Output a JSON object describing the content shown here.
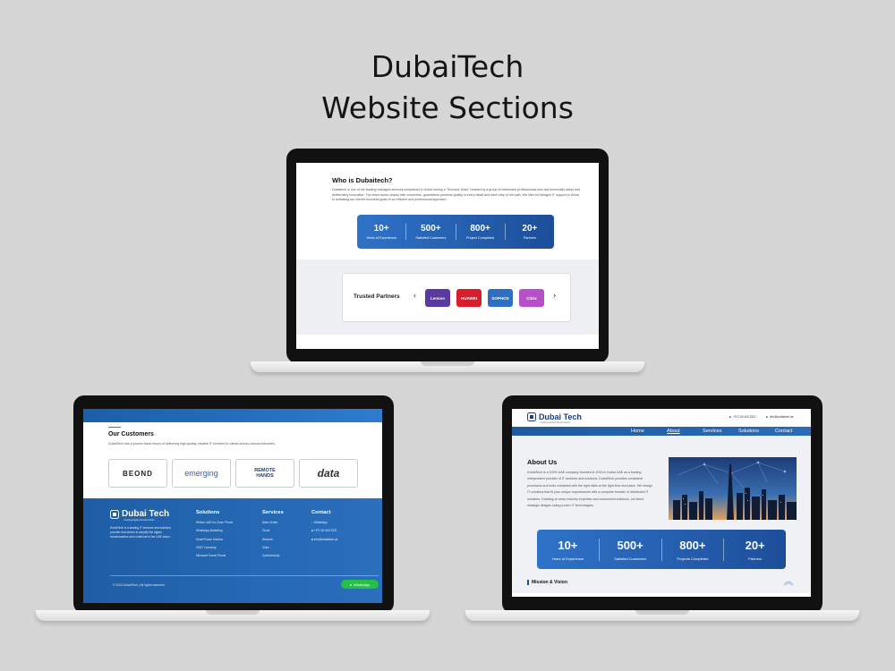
{
  "title_line1": "DubaiTech",
  "title_line2": "Website Sections",
  "screen_top": {
    "who_title": "Who is Dubaitech?",
    "who_text": "Dubaitech is one of the leading managed services companies in Dubai having a \"Success Team\" headed by a group of intellective professionals who are technically adept and deliberately innovative. The team works closely with customers, guarantees peerless quality in every detail and each step of the path. We offer full-fledged IT support in Dubai to activating our client's business goals in an efficient and professional approach.",
    "stats": [
      {
        "num": "10+",
        "label": "Years of Experience"
      },
      {
        "num": "500+",
        "label": "Satisfied Customers"
      },
      {
        "num": "800+",
        "label": "Project Completed"
      },
      {
        "num": "20+",
        "label": "Partners"
      }
    ],
    "partners_title": "Trusted Partners",
    "prev": "‹",
    "next": "›",
    "partner_logos": [
      {
        "name": "Lenovo",
        "color": "#5a3aa0"
      },
      {
        "name": "HUAWEI",
        "color": "#d81e2c"
      },
      {
        "name": "SOPHOS",
        "color": "#2d6fc1"
      },
      {
        "name": "Citrix",
        "color": "#b64fc8"
      }
    ]
  },
  "screen_left": {
    "customers_title": "Our Customers",
    "customers_text": "DubaiTech has a proven track record of delivering high-quality, reliable IT services to clients across various industries.",
    "customers": [
      "BEOND",
      "emerging",
      "REMOTE HANDS",
      "data"
    ],
    "brand": "Dubai Tech",
    "brand_tagline": "Creating digital transformation",
    "brand_desc": "DubaiTech is a leading IT services and solutions provider that strives to simplify the digital transformation and contribute to the UAE vision.",
    "solutions_title": "Solutions",
    "solutions": [
      "Ribbon UAE for Zoom Phone",
      "WhatsApp Marketing",
      "Smart Room Solution",
      "VSAT Licensing",
      "Microsoft Teams Phone"
    ],
    "services_title": "Services",
    "services": [
      "Data Center",
      "Cloud",
      "Network",
      "Voice",
      "Cybersecurity"
    ],
    "contact_title": "Contact",
    "contact_items": [
      "WhatsApp",
      "+971 50 400 3321",
      "info@dubaitech.ae"
    ],
    "copyright": "© 2024 DubaiTech | All rights reserved",
    "whatsapp_button": "WhatsApp"
  },
  "screen_right": {
    "logo": "Dubai Tech",
    "logo_tagline": "Creating digital transformation",
    "phone": "+971 50 400 3321",
    "email": "info@dubaitech.ae",
    "nav": [
      "Home",
      "About",
      "Services",
      "Solutions",
      "Contact"
    ],
    "about_title": "About Us",
    "about_text": "DubaiTech is a 100% UAE company founded in 2015 in Dubai UAE as a leading independent provider of IT services and solutions. DubaiTech provides consistent processes and tools combined with the right skills at the right time and place. We design IT solutions that fit your unique requirements with a complete breadth of distributed IT solutions. Drawing on deep industry expertise and customized solutions, we blend strategic designs using proven IT technologies.",
    "stats": [
      {
        "num": "10+",
        "label": "Years of Experience"
      },
      {
        "num": "500+",
        "label": "Satisfied Customers"
      },
      {
        "num": "800+",
        "label": "Projects Completed"
      },
      {
        "num": "20+",
        "label": "Partners"
      }
    ],
    "mission_title": "Mission & Vision"
  },
  "colors": {
    "accent": "#2b6fbd",
    "background": "#d6d6d6",
    "whatsapp": "#26c046"
  }
}
